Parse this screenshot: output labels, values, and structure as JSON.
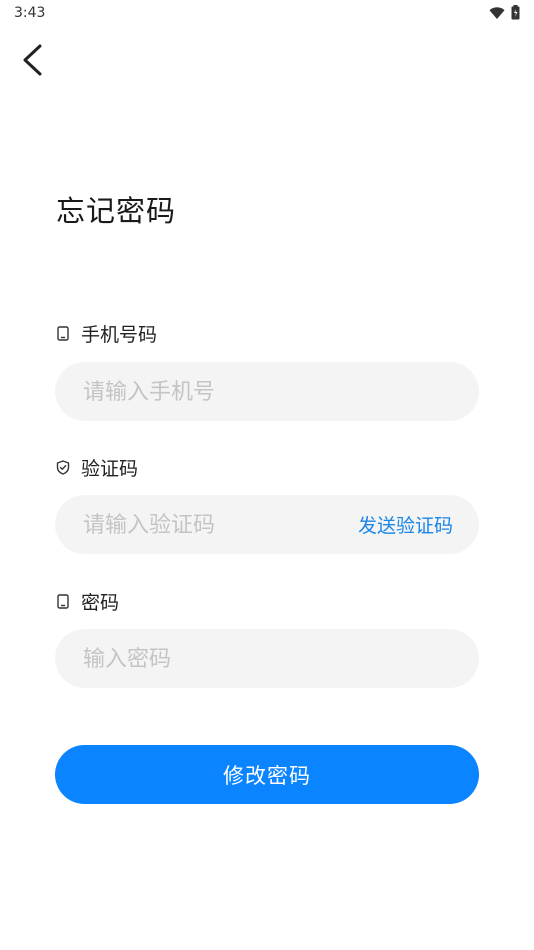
{
  "status_bar": {
    "time": "3:43",
    "icons": [
      "wifi-icon",
      "battery-icon"
    ]
  },
  "header": {
    "back_icon": "back-arrow-icon",
    "title": "忘记密码"
  },
  "form": {
    "phone": {
      "icon": "phone-icon",
      "label": "手机号码",
      "placeholder": "请输入手机号",
      "value": ""
    },
    "code": {
      "icon": "shield-icon",
      "label": "验证码",
      "placeholder": "请输入验证码",
      "value": "",
      "send_label": "发送验证码"
    },
    "password": {
      "icon": "phone-icon",
      "label": "密码",
      "placeholder": "输入密码",
      "value": ""
    },
    "submit_label": "修改密码"
  },
  "colors": {
    "accent": "#0a84ff",
    "link": "#1a86e8",
    "input_bg": "#f4f4f4",
    "placeholder": "#c4c4c4"
  }
}
